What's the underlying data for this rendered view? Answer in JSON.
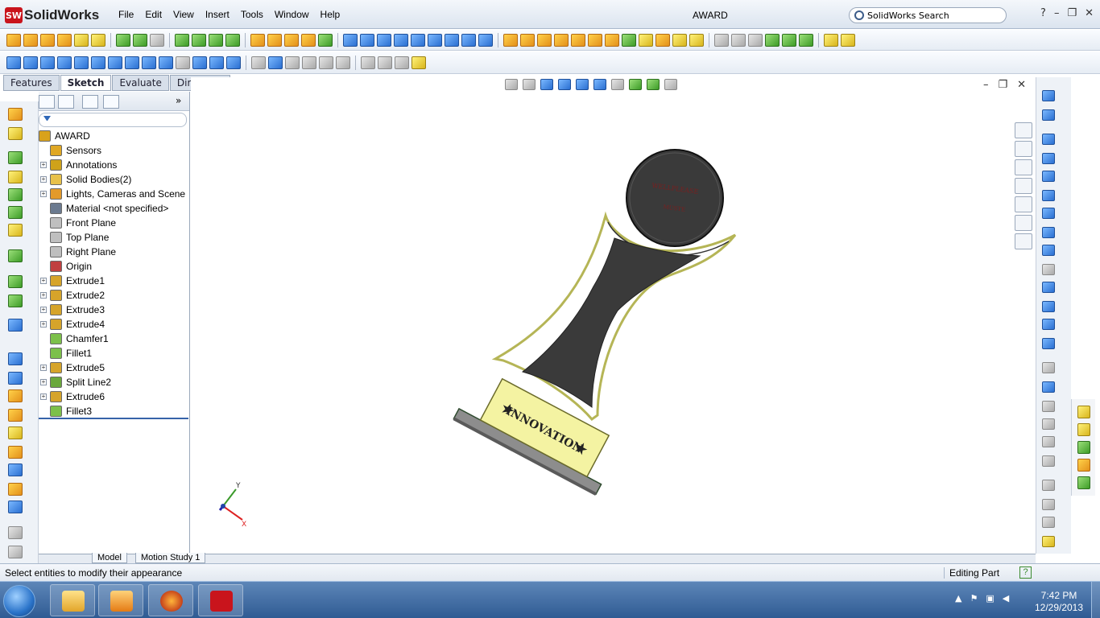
{
  "app": {
    "name": "SolidWorks",
    "logo_text": "SW",
    "document_title": "AWARD"
  },
  "menu": [
    "File",
    "Edit",
    "View",
    "Insert",
    "Tools",
    "Window",
    "Help"
  ],
  "search": {
    "placeholder": "SolidWorks Search"
  },
  "window_controls": {
    "help": "?",
    "minimize": "–",
    "restore": "❐",
    "close": "✕"
  },
  "command_tabs": [
    {
      "label": "Features",
      "active": false
    },
    {
      "label": "Sketch",
      "active": true
    },
    {
      "label": "Evaluate",
      "active": false
    },
    {
      "label": "DimXpert",
      "active": false
    }
  ],
  "feature_tree": [
    {
      "label": "AWARD",
      "icon": "part-icon",
      "expandable": false,
      "root": true
    },
    {
      "label": "Sensors",
      "icon": "sensor-icon",
      "expandable": false
    },
    {
      "label": "Annotations",
      "icon": "annotation-icon",
      "expandable": true
    },
    {
      "label": "Solid Bodies(2)",
      "icon": "folder-icon",
      "expandable": true
    },
    {
      "label": "Lights, Cameras and Scene",
      "icon": "lights-icon",
      "expandable": true
    },
    {
      "label": "Material <not specified>",
      "icon": "material-icon",
      "expandable": false
    },
    {
      "label": "Front Plane",
      "icon": "plane-icon",
      "expandable": false
    },
    {
      "label": "Top Plane",
      "icon": "plane-icon",
      "expandable": false
    },
    {
      "label": "Right Plane",
      "icon": "plane-icon",
      "expandable": false
    },
    {
      "label": "Origin",
      "icon": "origin-icon",
      "expandable": false
    },
    {
      "label": "Extrude1",
      "icon": "extrude-icon",
      "expandable": true
    },
    {
      "label": "Extrude2",
      "icon": "extrude-icon",
      "expandable": true
    },
    {
      "label": "Extrude3",
      "icon": "extrude-icon",
      "expandable": true
    },
    {
      "label": "Extrude4",
      "icon": "extrude-icon",
      "expandable": true
    },
    {
      "label": "Chamfer1",
      "icon": "chamfer-icon",
      "expandable": false
    },
    {
      "label": "Fillet1",
      "icon": "fillet-icon",
      "expandable": false
    },
    {
      "label": "Extrude5",
      "icon": "extrude-icon",
      "expandable": true
    },
    {
      "label": "Split Line2",
      "icon": "splitline-icon",
      "expandable": true
    },
    {
      "label": "Extrude6",
      "icon": "extrude-icon",
      "expandable": true
    },
    {
      "label": "Fillet3",
      "icon": "fillet-icon",
      "expandable": false
    }
  ],
  "bottom_tabs": [
    {
      "label": "Model"
    },
    {
      "label": "Motion Study 1"
    }
  ],
  "model": {
    "plaque_text": "INNOVATION",
    "disc_text_line1": "WELLPLEASE",
    "disc_text_line2": "MUSTE",
    "star": "★",
    "axis_x": "X",
    "axis_y": "Y",
    "colors": {
      "body": "#3a3a3a",
      "plaque": "#f4f3a2",
      "base": "#8d8d8d",
      "outline": "#c8c860"
    }
  },
  "status": {
    "message": "Select entities to modify their appearance",
    "mode": "Editing Part",
    "help": "?"
  },
  "taskbar": {
    "time": "7:42 PM",
    "date": "12/29/2013"
  }
}
